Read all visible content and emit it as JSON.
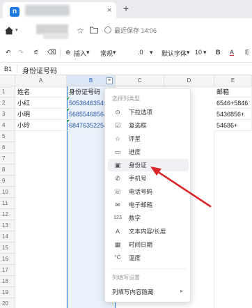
{
  "browser": {
    "tab_close": "×",
    "new_tab": "+",
    "app_logo_letter": "n"
  },
  "titlebar": {
    "save_status": "最近保存 14:06"
  },
  "toolbar": {
    "undo": "↶",
    "redo": "↷",
    "format_painter": "⚟",
    "eraser": "⌫",
    "insert_label": "插入",
    "insert_prefix": "⊕",
    "style_label": "常规",
    "decimal_label": ".0",
    "font_label": "默认字体",
    "size_label": "10",
    "bold_label": "B",
    "font_color_label": "A",
    "fill_label": "E"
  },
  "formula_bar": {
    "cell_ref": "B1",
    "value": "身份证号码"
  },
  "grid": {
    "columns": [
      "A",
      "B",
      "C",
      "D",
      "E"
    ],
    "rows": [
      "1",
      "2",
      "3",
      "4",
      "5",
      "6",
      "7",
      "8",
      "9",
      "10",
      "11",
      "12",
      "13",
      "14",
      "15",
      "16",
      "17",
      "18",
      "19",
      "20"
    ],
    "cells": {
      "a1": "姓名",
      "a2": "小红",
      "a3": "小明",
      "a4": "小玲",
      "b1": "身份证号码",
      "b2": "50536463546",
      "b3": "56855468564",
      "b4": "68476352254",
      "e1": "邮箱",
      "e2": "6546+5846",
      "e3": "5436856+",
      "e4": "54686+"
    }
  },
  "menu": {
    "section_title": "选择列类型",
    "items": [
      {
        "icon": "⊙",
        "label": "下拉选项"
      },
      {
        "icon": "☑",
        "label": "复选框"
      },
      {
        "icon": "☆",
        "label": "评星"
      },
      {
        "icon": "▭",
        "label": "进度"
      },
      {
        "icon": "▣",
        "label": "身份证"
      },
      {
        "icon": "✆",
        "label": "手机号"
      },
      {
        "icon": "☏",
        "label": "电话号码"
      },
      {
        "icon": "✉",
        "label": "电子邮箱"
      },
      {
        "icon": "123",
        "label": "数字"
      },
      {
        "icon": "A",
        "label": "文本内容/长度"
      },
      {
        "icon": "▦",
        "label": "时间日期"
      },
      {
        "icon": "°C",
        "label": "温度"
      }
    ],
    "section2_title": "列填写设置",
    "submenu_label": "列填写内容隐藏",
    "submenu_arrow": "▸"
  },
  "colors": {
    "accent": "#2f7de1",
    "arrow": "#d9262b"
  }
}
